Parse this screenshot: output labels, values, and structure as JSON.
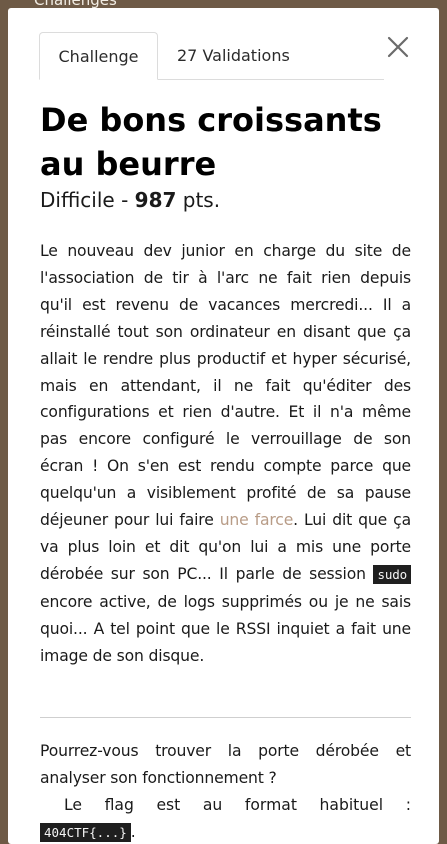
{
  "backdrop": {
    "text": "Challenges"
  },
  "tabs": [
    {
      "label": "Challenge",
      "active": true
    },
    {
      "label": "27 Validations",
      "active": false
    }
  ],
  "close_icon": "close-icon",
  "challenge": {
    "title": "De bons croissants au beurre",
    "difficulty": "Difficile",
    "separator": " - ",
    "points": "987",
    "points_unit": " pts."
  },
  "description": {
    "part1": "Le nouveau dev junior en charge du site de l'association de tir à l'arc ne fait rien depuis qu'il est revenu de vacances mercredi... Il a réinstallé tout son ordinateur en disant que ça allait le rendre plus productif et hyper sécurisé, mais en attendant, il ne fait qu'éditer des configurations et rien d'autre. Et il n'a même pas encore configuré le verrouillage de son écran ! On s'en est rendu compte parce que quelqu'un a visiblement profité de sa pause déjeuner pour lui faire ",
    "link_text": "une farce",
    "part2": ". Lui dit que ça va plus loin et dit qu'on lui a mis une porte dérobée sur son PC... Il parle de session ",
    "code": "sudo",
    "part3": " encore active, de logs supprimés ou je ne sais quoi... A tel point que le RSSI inquiet a fait une image de son disque."
  },
  "question": "Pourrez-vous trouver la porte dérobée et analyser son fonctionnement ?",
  "flag": {
    "words": [
      "Le",
      "flag",
      "est",
      "au",
      "format",
      "habituel",
      ":"
    ],
    "code": "404CTF{...}",
    "end": "."
  },
  "colors": {
    "backdrop": "#6e5a46",
    "link": "#b89c87",
    "code_bg": "#1f1f1f"
  }
}
